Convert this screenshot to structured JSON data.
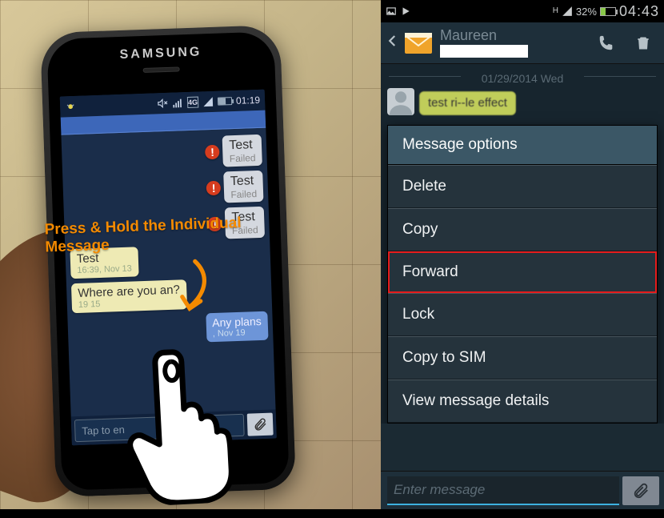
{
  "left": {
    "brand": "SAMSUNG",
    "status": {
      "time": "01:19"
    },
    "annotation": "Press & Hold the Individual Message",
    "messages": {
      "out": [
        {
          "text": "Test",
          "status": "Failed"
        },
        {
          "text": "Test",
          "status": "Failed"
        },
        {
          "text": "Test",
          "status": "Failed"
        }
      ],
      "in": [
        {
          "text": "Test",
          "ts": "16:39, Nov 13"
        },
        {
          "text": "Where are you       an?",
          "ts": "19       15"
        }
      ],
      "other": {
        "text": "Any plans",
        "ts": "  , Nov 19"
      }
    },
    "compose_placeholder": "Tap to en"
  },
  "right": {
    "status": {
      "batt_pct": "32%",
      "time": "04:43",
      "h_indicator": "H"
    },
    "contact": {
      "name": "Maureen"
    },
    "date_divider": "01/29/2014 Wed",
    "incoming_preview": "test ri--le effect",
    "dialog": {
      "title": "Message options",
      "items": [
        "Delete",
        "Copy",
        "Forward",
        "Lock",
        "Copy to SIM",
        "View message details"
      ],
      "highlighted_index": 2
    },
    "compose_placeholder": "Enter message"
  }
}
